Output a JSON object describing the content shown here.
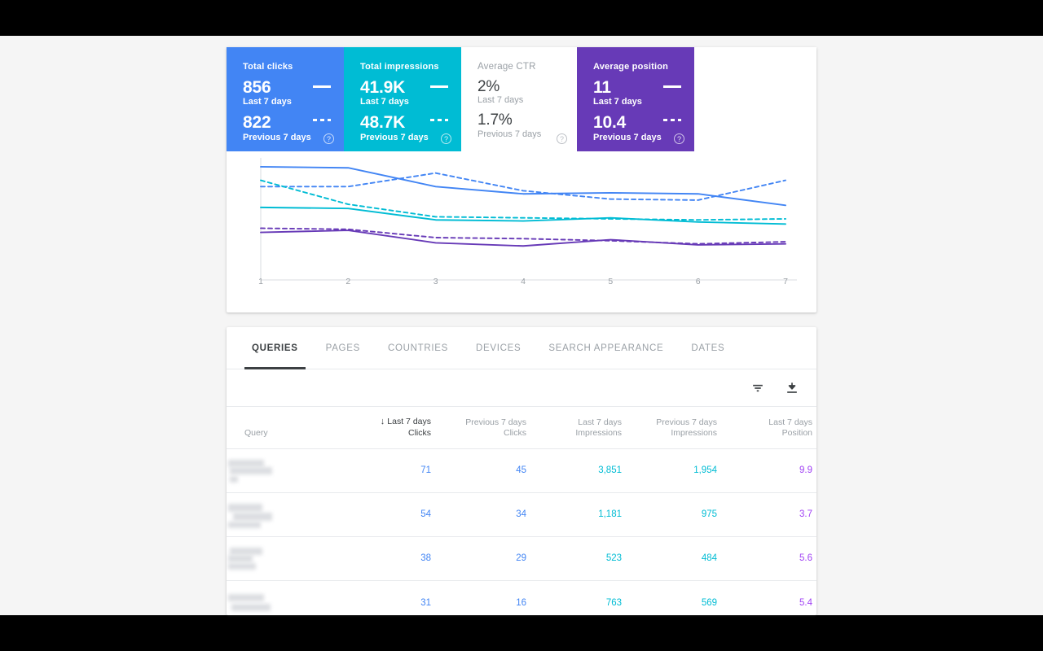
{
  "metrics": [
    {
      "id": "total-clicks",
      "title": "Total clicks",
      "current_value": "856",
      "current_label": "Last 7 days",
      "previous_value": "822",
      "previous_label": "Previous 7 days",
      "color": "#4285f4",
      "selected": true,
      "help": "?"
    },
    {
      "id": "total-impressions",
      "title": "Total impressions",
      "current_value": "41.9K",
      "current_label": "Last 7 days",
      "previous_value": "48.7K",
      "previous_label": "Previous 7 days",
      "color": "#00bcd4",
      "selected": true,
      "help": "?"
    },
    {
      "id": "average-ctr",
      "title": "Average CTR",
      "current_value": "2%",
      "current_label": "Last 7 days",
      "previous_value": "1.7%",
      "previous_label": "Previous 7 days",
      "color": "#ffffff",
      "selected": false,
      "help": "?"
    },
    {
      "id": "average-position",
      "title": "Average position",
      "current_value": "11",
      "current_label": "Last 7 days",
      "previous_value": "10.4",
      "previous_label": "Previous 7 days",
      "color": "#673ab7",
      "selected": true,
      "help": "?"
    }
  ],
  "chart_data": {
    "type": "line",
    "title": "",
    "xlabel": "",
    "ylabel": "",
    "x": [
      1,
      2,
      3,
      4,
      5,
      6,
      7
    ],
    "tick_labels": [
      "1",
      "2",
      "3",
      "4",
      "5",
      "6",
      "7"
    ],
    "grid": false,
    "legend": "none",
    "series": [
      {
        "name": "Clicks - Last 7 days",
        "color": "#4285f4",
        "style": "solid",
        "values": [
          0.93,
          0.92,
          0.74,
          0.67,
          0.68,
          0.67,
          0.56
        ]
      },
      {
        "name": "Clicks - Previous 7 days",
        "color": "#4285f4",
        "style": "dashed",
        "values": [
          0.74,
          0.74,
          0.87,
          0.7,
          0.62,
          0.61,
          0.8
        ]
      },
      {
        "name": "Impressions - Last 7 days",
        "color": "#00bcd4",
        "style": "solid",
        "values": [
          0.54,
          0.53,
          0.42,
          0.41,
          0.44,
          0.4,
          0.38
        ]
      },
      {
        "name": "Impressions - Previous 7 days",
        "color": "#00bcd4",
        "style": "dashed",
        "values": [
          0.8,
          0.57,
          0.45,
          0.44,
          0.43,
          0.42,
          0.43
        ]
      },
      {
        "name": "Position - Last 7 days",
        "color": "#673ab7",
        "style": "solid",
        "values": [
          0.3,
          0.32,
          0.2,
          0.17,
          0.23,
          0.18,
          0.19
        ]
      },
      {
        "name": "Position - Previous 7 days",
        "color": "#673ab7",
        "style": "dashed",
        "values": [
          0.34,
          0.33,
          0.25,
          0.24,
          0.22,
          0.19,
          0.21
        ]
      }
    ]
  },
  "tabs": [
    {
      "id": "queries",
      "label": "QUERIES",
      "active": true
    },
    {
      "id": "pages",
      "label": "PAGES",
      "active": false
    },
    {
      "id": "countries",
      "label": "COUNTRIES",
      "active": false
    },
    {
      "id": "devices",
      "label": "DEVICES",
      "active": false
    },
    {
      "id": "search-appearance",
      "label": "SEARCH APPEARANCE",
      "active": false
    },
    {
      "id": "dates",
      "label": "DATES",
      "active": false
    }
  ],
  "toolbar": {
    "filter_icon": "filter-icon",
    "download_icon": "download-icon"
  },
  "table": {
    "columns": [
      {
        "id": "query",
        "line1": "",
        "line2": "Query",
        "sorted": false
      },
      {
        "id": "clicks-last",
        "line1": "Last 7 days",
        "line2": "Clicks",
        "sorted": true,
        "sort_arrow": "↓"
      },
      {
        "id": "clicks-prev",
        "line1": "Previous 7 days",
        "line2": "Clicks",
        "sorted": false
      },
      {
        "id": "impressions-last",
        "line1": "Last 7 days",
        "line2": "Impressions",
        "sorted": false
      },
      {
        "id": "impressions-prev",
        "line1": "Previous 7 days",
        "line2": "Impressions",
        "sorted": false
      },
      {
        "id": "position-last",
        "line1": "Last 7 days",
        "line2": "Position",
        "sorted": false
      }
    ],
    "rows": [
      {
        "query": "",
        "clicks_last": "71",
        "clicks_prev": "45",
        "impressions_last": "3,851",
        "impressions_prev": "1,954",
        "position_last": "9.9"
      },
      {
        "query": "",
        "clicks_last": "54",
        "clicks_prev": "34",
        "impressions_last": "1,181",
        "impressions_prev": "975",
        "position_last": "3.7"
      },
      {
        "query": "",
        "clicks_last": "38",
        "clicks_prev": "29",
        "impressions_last": "523",
        "impressions_prev": "484",
        "position_last": "5.6"
      },
      {
        "query": "",
        "clicks_last": "31",
        "clicks_prev": "16",
        "impressions_last": "763",
        "impressions_prev": "569",
        "position_last": "5.4"
      }
    ]
  },
  "colors": {
    "clicks": "#4285f4",
    "impressions": "#00bcd4",
    "position": "#673ab7",
    "position_text": "#a142f4",
    "page_bg": "#f5f5f5",
    "text_primary": "#3c4043",
    "text_secondary": "#9aa0a6"
  }
}
